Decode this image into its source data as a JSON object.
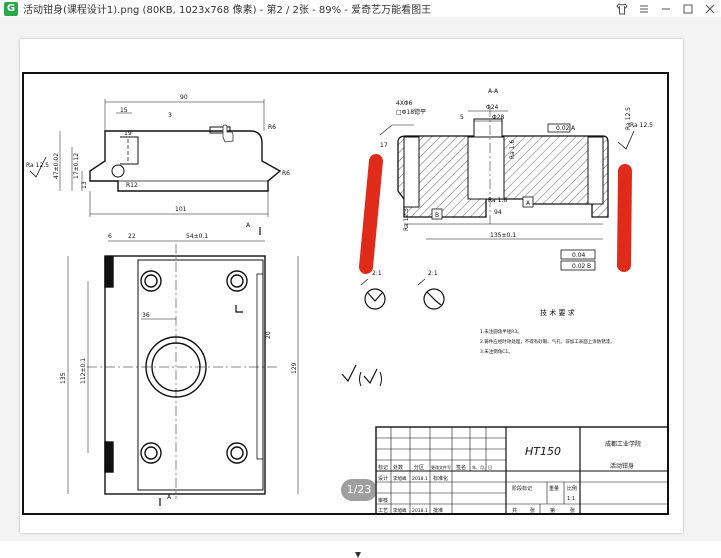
{
  "window": {
    "title": "活动钳身(课程设计1).png (80KB, 1023x768 像素) - 第2 / 2张 - 89% - 爱奇艺万能看图王",
    "app_icon_glyph": "G",
    "accent": "#2aa84a",
    "controls": [
      "shirt-icon",
      "menu-icon",
      "minimize-icon",
      "maximize-icon",
      "close-icon"
    ]
  },
  "viewer": {
    "page_indicator": "1/23"
  },
  "drawing": {
    "section_label": "A-A",
    "top_dims": [
      "90",
      "15",
      "3",
      "19",
      "R6",
      "R6",
      "101"
    ],
    "left_dims": [
      "Ra 12.5",
      "47±0.02",
      "17±0.12",
      "13",
      "R12"
    ],
    "plan_dims": [
      "6",
      "22",
      "54±0.1",
      "A",
      "A",
      "36",
      "135",
      "112±0.1",
      "20",
      "129"
    ],
    "section_dims": [
      "4XΦ6",
      "□Φ18锪平",
      "5",
      "Φ24",
      "Φ28",
      "0.02",
      "A",
      "Ra 12.5",
      "Ra 12.5",
      "Ra 1.6",
      "Ra 1.6",
      "A",
      "B",
      "94",
      "Ra 12.5",
      "135±0.1",
      "0.04",
      "0.02",
      "B",
      "17"
    ],
    "detail_labels": [
      "2:1",
      "2:1"
    ],
    "notes_title": "技 术 要 求",
    "notes": [
      "1.未注圆角半径R3。",
      "2.铸件应经时效处理，不得有砂眼、气孔，非加工表面上涂防锈漆。",
      "3.未注倒角C1。"
    ],
    "title_block": {
      "material": "HT150",
      "school": "成都工业学院",
      "part_name": "活动钳身",
      "row_labels": [
        "标记",
        "处数",
        "分区",
        "更改文件号",
        "签名",
        "年、月、日"
      ],
      "designer_row": [
        "设计",
        "李旭峰",
        "2018.1",
        "标准化"
      ],
      "review": "审核",
      "process_row": [
        "工艺",
        "李旭峰",
        "2018.1",
        "批准"
      ],
      "stage_label": "阶段标记",
      "weight_label": "重量",
      "scale_label": "比例",
      "scale": "1:1",
      "sheet_row": [
        "共",
        "张",
        "第",
        "张"
      ]
    }
  }
}
